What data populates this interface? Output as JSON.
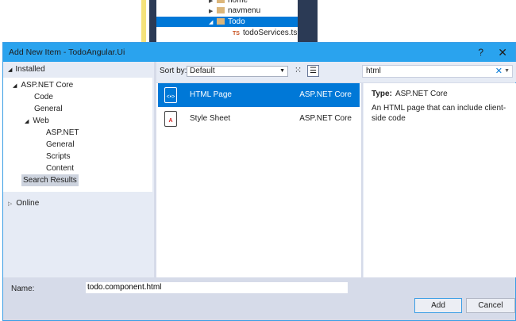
{
  "background": {
    "solution_explorer": [
      {
        "label": "home",
        "expander": "collapsed"
      },
      {
        "label": "navmenu",
        "expander": "collapsed"
      },
      {
        "label": "Todo",
        "expander": "expanded",
        "selected": true
      },
      {
        "label": "todoServices.ts",
        "badge": "TS"
      }
    ]
  },
  "dialog": {
    "title": "Add New Item - TodoAngular.Ui",
    "help": "?",
    "close": "✕",
    "left": {
      "installed": "Installed",
      "tree": [
        {
          "label": "ASP.NET Core",
          "level": 1,
          "expander": "▲"
        },
        {
          "label": "Code",
          "level": 2
        },
        {
          "label": "General",
          "level": 2
        },
        {
          "label": "Web",
          "level": 2,
          "expander": "▲"
        },
        {
          "label": "ASP.NET",
          "level": 3
        },
        {
          "label": "General",
          "level": 3
        },
        {
          "label": "Scripts",
          "level": 3
        },
        {
          "label": "Content",
          "level": 3
        },
        {
          "label": "Search Results",
          "level": 0,
          "selected": true
        }
      ],
      "online": "Online"
    },
    "toolbar": {
      "sort_label": "Sort by:",
      "sort_value": "Default",
      "search_value": "html"
    },
    "items": [
      {
        "name": "HTML Page",
        "type": "ASP.NET Core",
        "selected": true,
        "icon": "html-page-icon"
      },
      {
        "name": "Style Sheet",
        "type": "ASP.NET Core",
        "selected": false,
        "icon": "stylesheet-icon"
      }
    ],
    "details": {
      "type_label": "Type:",
      "type_value": "ASP.NET Core",
      "description": "An HTML page that can include client-side code"
    },
    "name_label": "Name:",
    "name_value": "todo.component.html",
    "add": "Add",
    "cancel": "Cancel"
  }
}
